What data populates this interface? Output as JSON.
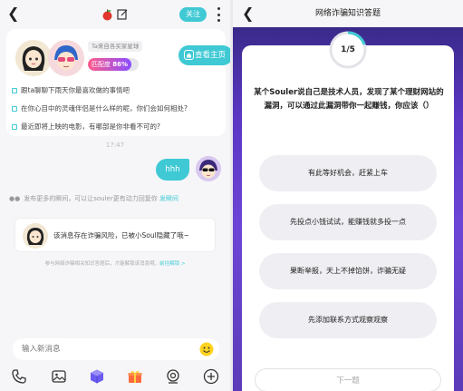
{
  "chat": {
    "follow_label": "关注",
    "profile": {
      "source_tag": "Ta来自各买家星球",
      "match_label": "匹配度",
      "match_value": "86%",
      "match_fraction": 0.86,
      "home_label": "查看主页",
      "prompts": [
        "跟ta聊聊下雨天你最喜欢做的事情吧",
        "在你心目中的灵魂伴侣是什么样的呢，你们会如何相处?",
        "最近即将上映的电影，有哪部是你非看不可的?"
      ]
    },
    "timestamp": "17:47",
    "message": "hhh",
    "moment_tip": "发布更多的瞬间，可以让souler更有动力回复你",
    "moment_link": "发瞬间",
    "warning": "该消息存在诈骗风险，已被小Soul隐藏了哦~",
    "fraud_note": "参与网络诈骗相关知识答题后，才能解锁该消息哦，",
    "fraud_link": "前往解锁 >",
    "input_placeholder": "输入新消息"
  },
  "quiz": {
    "title": "网络诈骗知识答题",
    "progress": "1/5",
    "progress_fraction": 0.2,
    "question": "某个Souler说自己是技术人员，发现了某个理财网站的漏洞，可以通过此漏洞带你一起赚钱，你应该（）",
    "options": [
      "有此等好机会，赶紧上车",
      "先投点小钱试试，能赚钱就多投一点",
      "果断举报，天上不掉馅饼，诈骗无疑",
      "先添加联系方式观察观察"
    ],
    "next_label": "下一题"
  },
  "colors": {
    "accent": "#3fc9d4",
    "quiz_bg": "#5b37c4"
  }
}
